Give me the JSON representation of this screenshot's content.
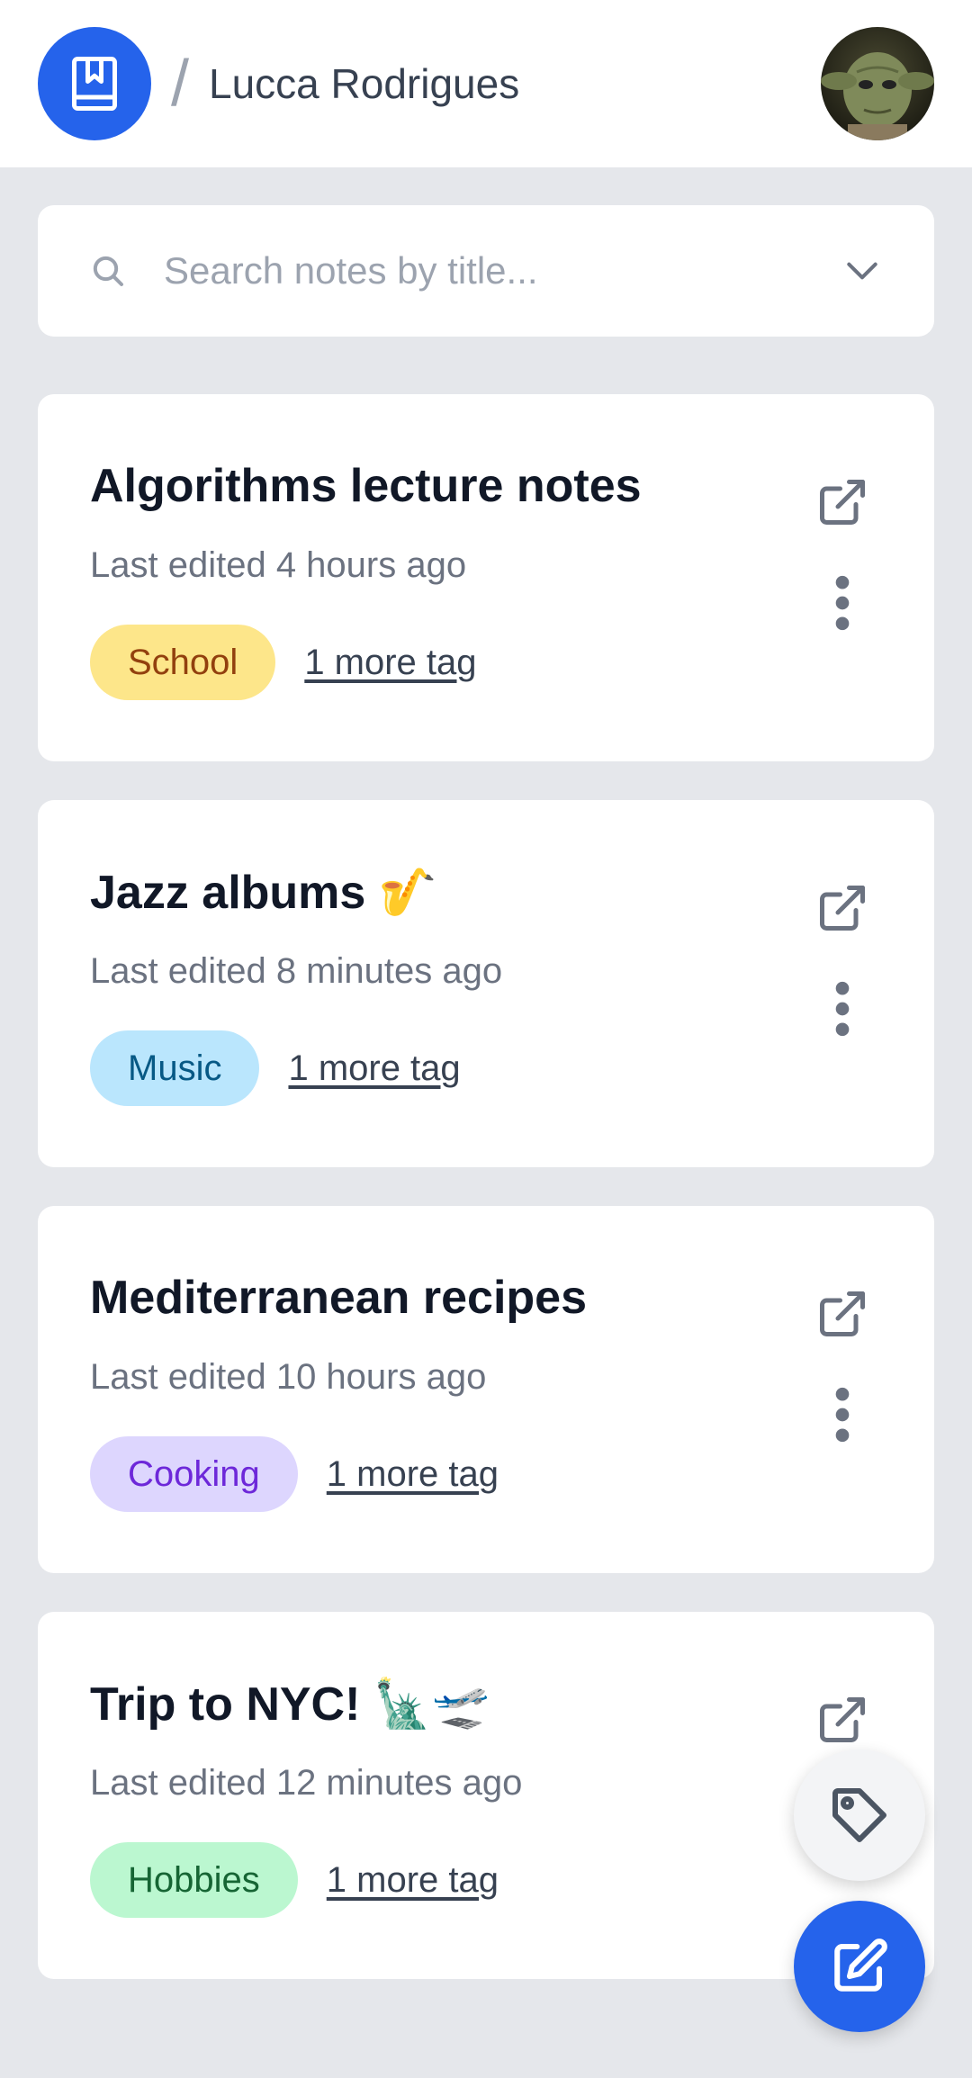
{
  "header": {
    "logo_icon": "book-icon",
    "separator": "/",
    "username": "Lucca Rodrigues",
    "avatar_icon": "avatar"
  },
  "search": {
    "placeholder": "Search notes by title...",
    "search_icon": "search-icon",
    "dropdown_icon": "chevron-down-icon"
  },
  "notes": [
    {
      "title": "Algorithms lecture notes",
      "edited": "Last edited 4 hours ago",
      "tag": "School",
      "tag_bg": "#fde68a",
      "tag_color": "#92400e",
      "more": "1 more tag"
    },
    {
      "title": "Jazz albums 🎷",
      "edited": "Last edited 8 minutes ago",
      "tag": "Music",
      "tag_bg": "#bae6fd",
      "tag_color": "#075985",
      "more": "1 more tag"
    },
    {
      "title": "Mediterranean recipes",
      "edited": "Last edited 10 hours ago",
      "tag": "Cooking",
      "tag_bg": "#ddd6fe",
      "tag_color": "#6d28d9",
      "more": "1 more tag"
    },
    {
      "title": "Trip to NYC! 🗽🛫",
      "edited": "Last edited 12 minutes ago",
      "tag": "Hobbies",
      "tag_bg": "#bbf7d0",
      "tag_color": "#166534",
      "more": "1 more tag"
    }
  ],
  "fabs": {
    "tag_icon": "tag-icon",
    "edit_icon": "edit-icon"
  },
  "colors": {
    "accent": "#2563eb",
    "background": "#e5e7eb"
  }
}
